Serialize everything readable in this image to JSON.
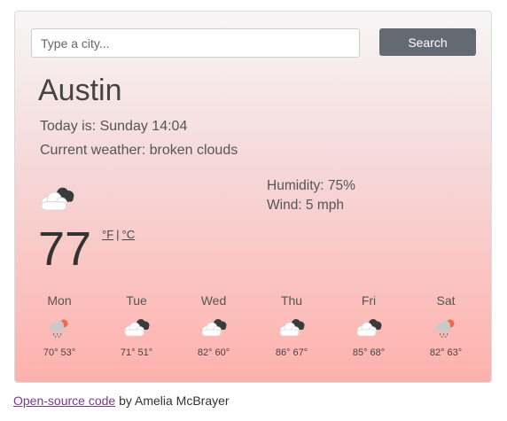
{
  "search": {
    "placeholder": "Type a city...",
    "button_label": "Search"
  },
  "city": "Austin",
  "today_text": "Today is: Sunday 14:04",
  "current_weather_text": "Current weather: broken clouds",
  "humidity_text": "Humidity: 75%",
  "wind_text": "Wind: 5 mph",
  "temperature": "77",
  "units": {
    "fahrenheit": "°F",
    "separator": "|",
    "celsius": "°C"
  },
  "main_icon": "broken-clouds-icon",
  "forecast": [
    {
      "day": "Mon",
      "icon": "rain-snow-sun-icon",
      "temps": "70° 53°"
    },
    {
      "day": "Tue",
      "icon": "broken-clouds-icon",
      "temps": "71° 51°"
    },
    {
      "day": "Wed",
      "icon": "broken-clouds-icon",
      "temps": "82° 60°"
    },
    {
      "day": "Thu",
      "icon": "broken-clouds-icon",
      "temps": "86° 67°"
    },
    {
      "day": "Fri",
      "icon": "broken-clouds-icon",
      "temps": "85° 68°"
    },
    {
      "day": "Sat",
      "icon": "rain-snow-sun-icon",
      "temps": "82° 63°"
    }
  ],
  "footer": {
    "link_text": "Open-source code",
    "suffix": " by Amelia McBrayer"
  },
  "colors": {
    "button": "#646a71",
    "gradient_top": "#f6f6f6",
    "gradient_bottom": "#feb1ac",
    "link": "#7b3a8c"
  }
}
